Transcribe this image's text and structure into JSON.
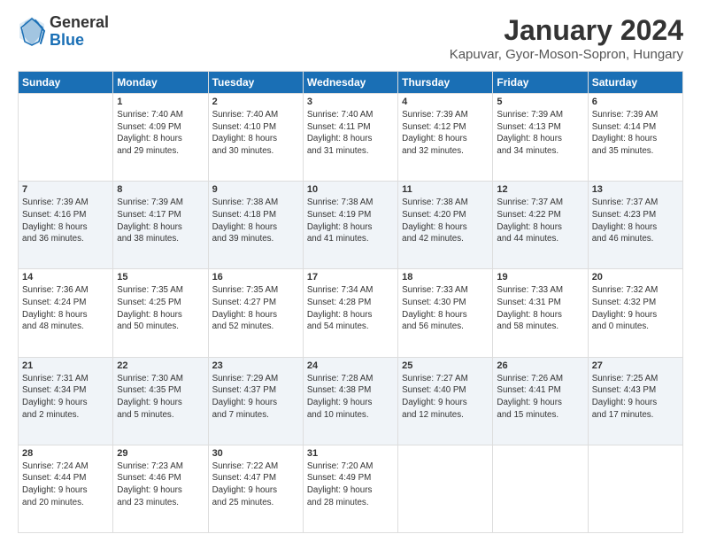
{
  "logo": {
    "general": "General",
    "blue": "Blue"
  },
  "title": "January 2024",
  "location": "Kapuvar, Gyor-Moson-Sopron, Hungary",
  "days_of_week": [
    "Sunday",
    "Monday",
    "Tuesday",
    "Wednesday",
    "Thursday",
    "Friday",
    "Saturday"
  ],
  "weeks": [
    [
      {
        "day": "",
        "info": ""
      },
      {
        "day": "1",
        "info": "Sunrise: 7:40 AM\nSunset: 4:09 PM\nDaylight: 8 hours\nand 29 minutes."
      },
      {
        "day": "2",
        "info": "Sunrise: 7:40 AM\nSunset: 4:10 PM\nDaylight: 8 hours\nand 30 minutes."
      },
      {
        "day": "3",
        "info": "Sunrise: 7:40 AM\nSunset: 4:11 PM\nDaylight: 8 hours\nand 31 minutes."
      },
      {
        "day": "4",
        "info": "Sunrise: 7:39 AM\nSunset: 4:12 PM\nDaylight: 8 hours\nand 32 minutes."
      },
      {
        "day": "5",
        "info": "Sunrise: 7:39 AM\nSunset: 4:13 PM\nDaylight: 8 hours\nand 34 minutes."
      },
      {
        "day": "6",
        "info": "Sunrise: 7:39 AM\nSunset: 4:14 PM\nDaylight: 8 hours\nand 35 minutes."
      }
    ],
    [
      {
        "day": "7",
        "info": "Sunrise: 7:39 AM\nSunset: 4:16 PM\nDaylight: 8 hours\nand 36 minutes."
      },
      {
        "day": "8",
        "info": "Sunrise: 7:39 AM\nSunset: 4:17 PM\nDaylight: 8 hours\nand 38 minutes."
      },
      {
        "day": "9",
        "info": "Sunrise: 7:38 AM\nSunset: 4:18 PM\nDaylight: 8 hours\nand 39 minutes."
      },
      {
        "day": "10",
        "info": "Sunrise: 7:38 AM\nSunset: 4:19 PM\nDaylight: 8 hours\nand 41 minutes."
      },
      {
        "day": "11",
        "info": "Sunrise: 7:38 AM\nSunset: 4:20 PM\nDaylight: 8 hours\nand 42 minutes."
      },
      {
        "day": "12",
        "info": "Sunrise: 7:37 AM\nSunset: 4:22 PM\nDaylight: 8 hours\nand 44 minutes."
      },
      {
        "day": "13",
        "info": "Sunrise: 7:37 AM\nSunset: 4:23 PM\nDaylight: 8 hours\nand 46 minutes."
      }
    ],
    [
      {
        "day": "14",
        "info": "Sunrise: 7:36 AM\nSunset: 4:24 PM\nDaylight: 8 hours\nand 48 minutes."
      },
      {
        "day": "15",
        "info": "Sunrise: 7:35 AM\nSunset: 4:25 PM\nDaylight: 8 hours\nand 50 minutes."
      },
      {
        "day": "16",
        "info": "Sunrise: 7:35 AM\nSunset: 4:27 PM\nDaylight: 8 hours\nand 52 minutes."
      },
      {
        "day": "17",
        "info": "Sunrise: 7:34 AM\nSunset: 4:28 PM\nDaylight: 8 hours\nand 54 minutes."
      },
      {
        "day": "18",
        "info": "Sunrise: 7:33 AM\nSunset: 4:30 PM\nDaylight: 8 hours\nand 56 minutes."
      },
      {
        "day": "19",
        "info": "Sunrise: 7:33 AM\nSunset: 4:31 PM\nDaylight: 8 hours\nand 58 minutes."
      },
      {
        "day": "20",
        "info": "Sunrise: 7:32 AM\nSunset: 4:32 PM\nDaylight: 9 hours\nand 0 minutes."
      }
    ],
    [
      {
        "day": "21",
        "info": "Sunrise: 7:31 AM\nSunset: 4:34 PM\nDaylight: 9 hours\nand 2 minutes."
      },
      {
        "day": "22",
        "info": "Sunrise: 7:30 AM\nSunset: 4:35 PM\nDaylight: 9 hours\nand 5 minutes."
      },
      {
        "day": "23",
        "info": "Sunrise: 7:29 AM\nSunset: 4:37 PM\nDaylight: 9 hours\nand 7 minutes."
      },
      {
        "day": "24",
        "info": "Sunrise: 7:28 AM\nSunset: 4:38 PM\nDaylight: 9 hours\nand 10 minutes."
      },
      {
        "day": "25",
        "info": "Sunrise: 7:27 AM\nSunset: 4:40 PM\nDaylight: 9 hours\nand 12 minutes."
      },
      {
        "day": "26",
        "info": "Sunrise: 7:26 AM\nSunset: 4:41 PM\nDaylight: 9 hours\nand 15 minutes."
      },
      {
        "day": "27",
        "info": "Sunrise: 7:25 AM\nSunset: 4:43 PM\nDaylight: 9 hours\nand 17 minutes."
      }
    ],
    [
      {
        "day": "28",
        "info": "Sunrise: 7:24 AM\nSunset: 4:44 PM\nDaylight: 9 hours\nand 20 minutes."
      },
      {
        "day": "29",
        "info": "Sunrise: 7:23 AM\nSunset: 4:46 PM\nDaylight: 9 hours\nand 23 minutes."
      },
      {
        "day": "30",
        "info": "Sunrise: 7:22 AM\nSunset: 4:47 PM\nDaylight: 9 hours\nand 25 minutes."
      },
      {
        "day": "31",
        "info": "Sunrise: 7:20 AM\nSunset: 4:49 PM\nDaylight: 9 hours\nand 28 minutes."
      },
      {
        "day": "",
        "info": ""
      },
      {
        "day": "",
        "info": ""
      },
      {
        "day": "",
        "info": ""
      }
    ]
  ]
}
